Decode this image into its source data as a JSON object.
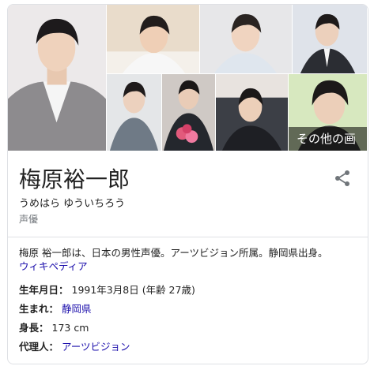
{
  "gallery": {
    "more_label": "その他の画像"
  },
  "entity": {
    "name": "梅原裕一郎",
    "reading": "うめはら ゆういちろう",
    "category": "声優"
  },
  "description": {
    "text": "梅原 裕一郎は、日本の男性声優。アーツビジョン所属。静岡県出身。",
    "source_link": "ウィキペディア"
  },
  "facts": [
    {
      "label": "生年月日：",
      "value": "1991年3月8日 (年齢 27歳)",
      "link": false
    },
    {
      "label": "生まれ：",
      "value": "静岡県",
      "link": true
    },
    {
      "label": "身長：",
      "value": "173 cm",
      "link": false
    },
    {
      "label": "代理人：",
      "value": "アーツビジョン",
      "link": true
    }
  ],
  "colors": {
    "link": "#1a0dab",
    "muted": "#70757a",
    "border": "#dfe1e5"
  },
  "icons": {
    "share": "share-icon"
  }
}
